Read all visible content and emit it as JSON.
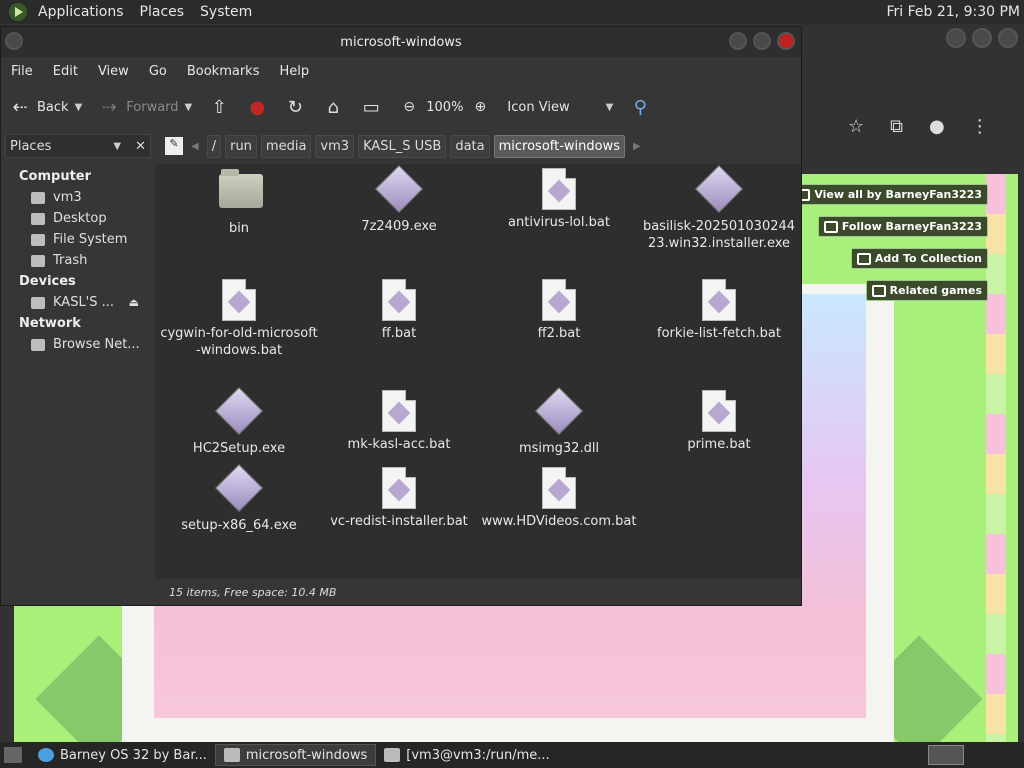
{
  "top_panel": {
    "menus": [
      "Applications",
      "Places",
      "System"
    ],
    "clock": "Fri Feb 21,  9:30 PM"
  },
  "browser": {
    "page_buttons": [
      "View all by BarneyFan3223",
      "Follow BarneyFan3223",
      "Add To Collection",
      "Related games"
    ]
  },
  "file_manager": {
    "title": "microsoft-windows",
    "menu": [
      "File",
      "Edit",
      "View",
      "Go",
      "Bookmarks",
      "Help"
    ],
    "toolbar": {
      "back": "Back",
      "forward": "Forward",
      "zoom": "100%",
      "view_mode": "Icon View"
    },
    "places_select": "Places",
    "breadcrumbs": [
      "/",
      "run",
      "media",
      "vm3",
      "KASL_S USB",
      "data",
      "microsoft-windows"
    ],
    "sidebar": {
      "computer_heading": "Computer",
      "computer_items": [
        "vm3",
        "Desktop",
        "File System",
        "Trash"
      ],
      "devices_heading": "Devices",
      "device_items": [
        "KASL'S ..."
      ],
      "network_heading": "Network",
      "network_items": [
        "Browse Net..."
      ]
    },
    "files": [
      {
        "name": "bin",
        "type": "folder"
      },
      {
        "name": "7z2409.exe",
        "type": "exe"
      },
      {
        "name": "antivirus-lol.bat",
        "type": "doc"
      },
      {
        "name": "basilisk-20250103024423.win32.installer.exe",
        "type": "exe"
      },
      {
        "name": "cygwin-for-old-microsoft-windows.bat",
        "type": "doc"
      },
      {
        "name": "ff.bat",
        "type": "doc"
      },
      {
        "name": "ff2.bat",
        "type": "doc"
      },
      {
        "name": "forkie-list-fetch.bat",
        "type": "doc"
      },
      {
        "name": "HC2Setup.exe",
        "type": "exe"
      },
      {
        "name": "mk-kasl-acc.bat",
        "type": "doc"
      },
      {
        "name": "msimg32.dll",
        "type": "exe"
      },
      {
        "name": "prime.bat",
        "type": "doc"
      },
      {
        "name": "setup-x86_64.exe",
        "type": "exe"
      },
      {
        "name": "vc-redist-installer.bat",
        "type": "doc"
      },
      {
        "name": "www.HDVideos.com.bat",
        "type": "doc"
      }
    ],
    "status": "15 items, Free space: 10.4 MB"
  },
  "taskbar": {
    "tasks": [
      "Barney OS 32 by Bar...",
      "microsoft-windows",
      "[vm3@vm3:/run/me..."
    ]
  }
}
